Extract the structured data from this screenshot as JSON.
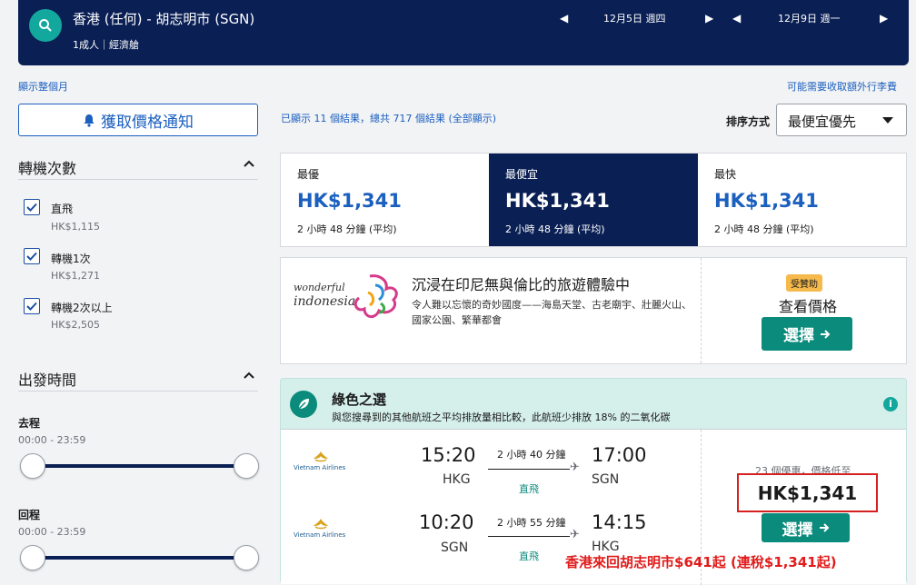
{
  "header": {
    "route": "香港 (任何) - 胡志明市 (SGN)",
    "passengers": "1成人｜經濟艙",
    "depart_date": "12月5日 週四",
    "return_date": "12月9日 週一"
  },
  "links": {
    "show_month": "顯示整個月",
    "baggage_fee": "可能需要收取額外行李費"
  },
  "alert_button": "獲取價格通知",
  "filters": {
    "stops_title": "轉機次數",
    "stops": [
      {
        "label": "直飛",
        "price": "HK$1,115",
        "checked": true
      },
      {
        "label": "轉機1次",
        "price": "HK$1,271",
        "checked": true
      },
      {
        "label": "轉機2次以上",
        "price": "HK$2,505",
        "checked": true
      }
    ],
    "time_title": "出發時間",
    "outbound_label": "去程",
    "outbound_range": "00:00 - 23:59",
    "return_label": "回程",
    "return_range": "00:00 - 23:59"
  },
  "results": {
    "count_text": "已顯示 11 個結果，總共 717 個結果 (全部顯示)",
    "sort_label": "排序方式",
    "sort_value": "最便宜優先"
  },
  "tabs": [
    {
      "name": "最優",
      "price": "HK$1,341",
      "duration": "2 小時 48 分鐘 (平均)",
      "active": false
    },
    {
      "name": "最便宜",
      "price": "HK$1,341",
      "duration": "2 小時 48 分鐘 (平均)",
      "active": true
    },
    {
      "name": "最快",
      "price": "HK$1,341",
      "duration": "2 小時 48 分鐘 (平均)",
      "active": false
    }
  ],
  "ad": {
    "logo_text_top": "wonderful",
    "logo_text_bottom": "indonesia",
    "title": "沉浸在印尼無與倫比的旅遊體驗中",
    "description": "令人難以忘懷的奇妙國度——海島天堂、古老廟宇、壯麗火山、國家公園、繁華都會",
    "badge": "受贊助",
    "view_price": "查看價格",
    "select": "選擇"
  },
  "green": {
    "title": "綠色之選",
    "description": "與您搜尋到的其他航班之平均排放量相比較，此航班少排放 18% 的二氧化碳",
    "info": "i"
  },
  "flight": {
    "airline": "Vietnam Airlines",
    "outbound": {
      "dep_time": "15:20",
      "dep_code": "HKG",
      "arr_time": "17:00",
      "arr_code": "SGN",
      "duration": "2 小時 40 分鐘",
      "stops": "直飛"
    },
    "inbound": {
      "dep_time": "10:20",
      "dep_code": "SGN",
      "arr_time": "14:15",
      "arr_code": "HKG",
      "duration": "2 小時 55 分鐘",
      "stops": "直飛"
    },
    "deals": "23 個優惠，價格低至",
    "price": "HK$1,341",
    "select": "選擇"
  },
  "promo_text": "香港來回胡志明市$641起 (連稅$1,341起)",
  "colors": {
    "navy": "#0a1f54",
    "teal": "#0b8b7c",
    "link": "#1b5fbf",
    "red": "#d42020"
  }
}
